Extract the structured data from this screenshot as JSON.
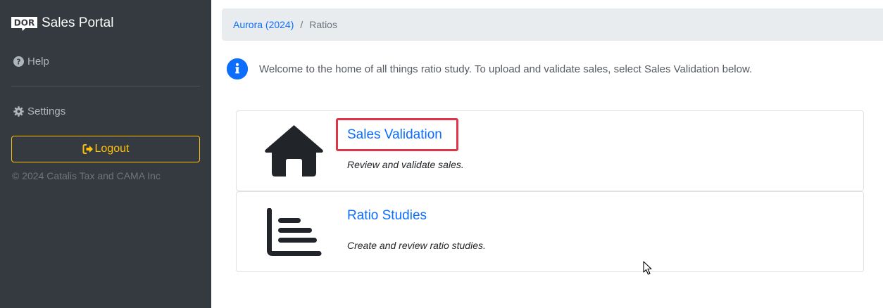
{
  "sidebar": {
    "brand_logo_text": "DOR",
    "brand_title": "Sales Portal",
    "help_label": "Help",
    "settings_label": "Settings",
    "logout_label": "Logout",
    "copyright": "© 2024 Catalis Tax and CAMA Inc"
  },
  "breadcrumb": {
    "parent": "Aurora (2024)",
    "separator": "/",
    "current": "Ratios"
  },
  "info": {
    "message": "Welcome to the home of all things ratio study. To upload and validate sales, select Sales Validation below."
  },
  "cards": [
    {
      "title": "Sales Validation",
      "description": "Review and validate sales.",
      "icon": "house-icon"
    },
    {
      "title": "Ratio Studies",
      "description": "Create and review ratio studies.",
      "icon": "chart-bar-icon"
    }
  ],
  "colors": {
    "sidebar_bg": "#343a40",
    "link": "#0d6efd",
    "warning": "#ffc107",
    "highlight": "#dc3545",
    "breadcrumb_bg": "#e9ecef"
  }
}
